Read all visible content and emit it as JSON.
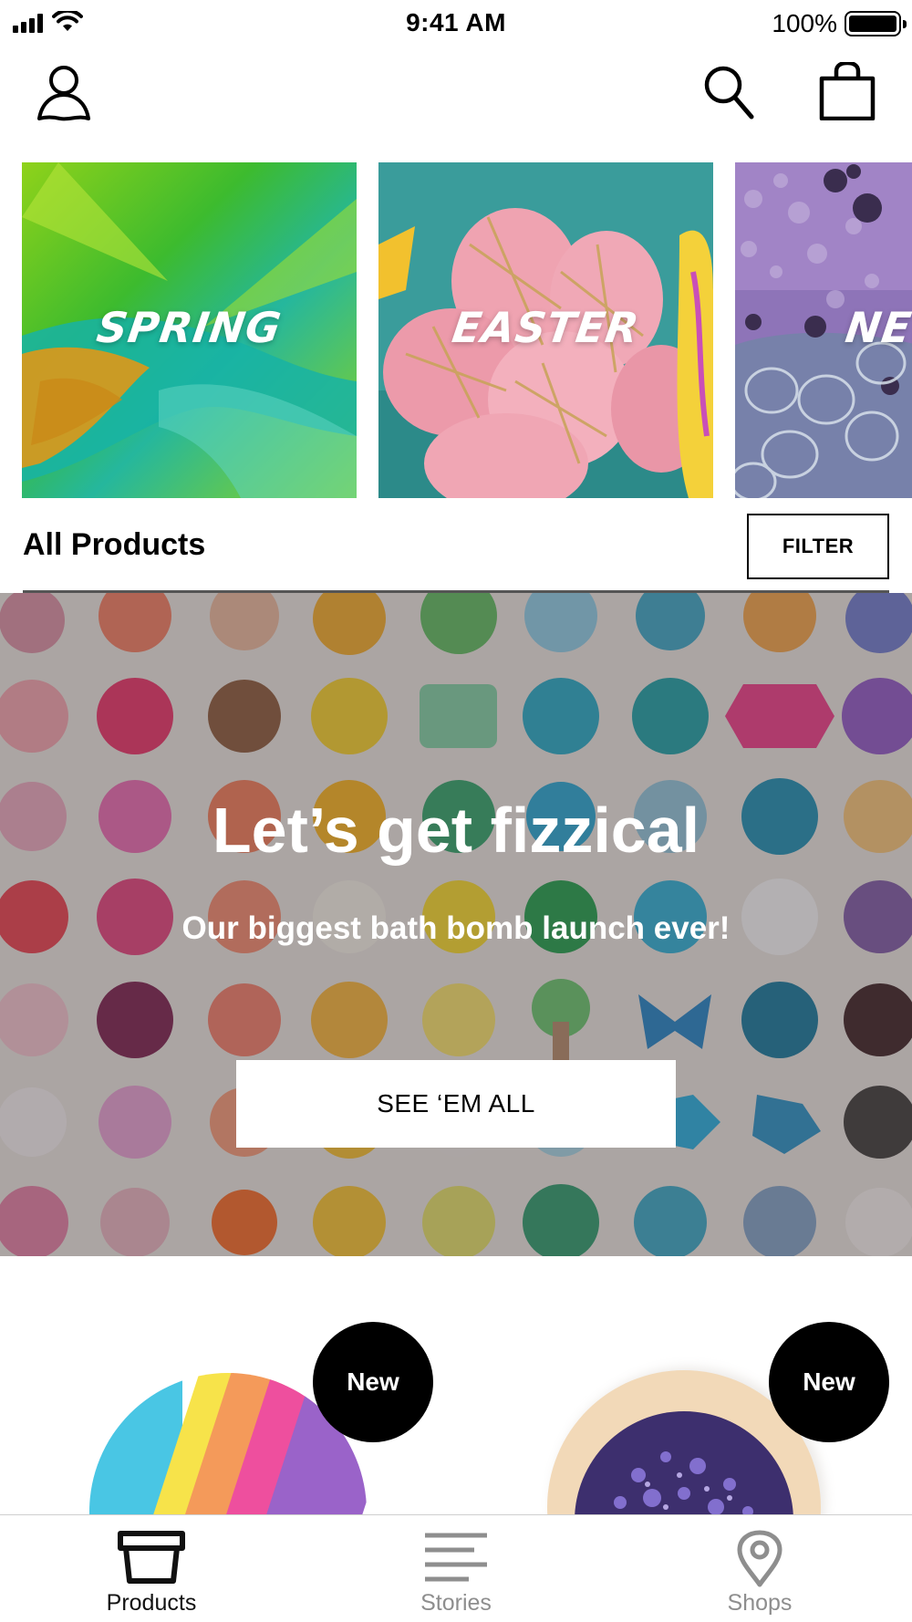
{
  "status_bar": {
    "time": "9:41 AM",
    "battery_percent": "100%",
    "icons": [
      "signal-icon",
      "wifi-icon",
      "battery-icon"
    ]
  },
  "top_nav": {
    "icons": [
      "account-icon",
      "search-icon",
      "shopping-bag-icon"
    ]
  },
  "categories": [
    {
      "label": "SPRING"
    },
    {
      "label": "EASTER"
    },
    {
      "label": "NEW"
    }
  ],
  "section": {
    "title": "All Products",
    "filter_label": "FILTER"
  },
  "hero": {
    "title": "Let’s get fizzical",
    "subtitle": "Our biggest bath bomb launch ever!",
    "button_label": "SEE ‘EM ALL"
  },
  "products": [
    {
      "badge": "New"
    },
    {
      "badge": "New"
    }
  ],
  "tab_bar": {
    "tabs": [
      {
        "label": "Products",
        "icon": "products-tub-icon",
        "active": true
      },
      {
        "label": "Stories",
        "icon": "stories-lines-icon",
        "active": false
      },
      {
        "label": "Shops",
        "icon": "map-pin-icon",
        "active": false
      }
    ]
  },
  "colors": {
    "active_tab": "#111111",
    "inactive_tab": "#8e8e8e",
    "badge_bg": "#000000",
    "hero_text": "#ffffff"
  }
}
